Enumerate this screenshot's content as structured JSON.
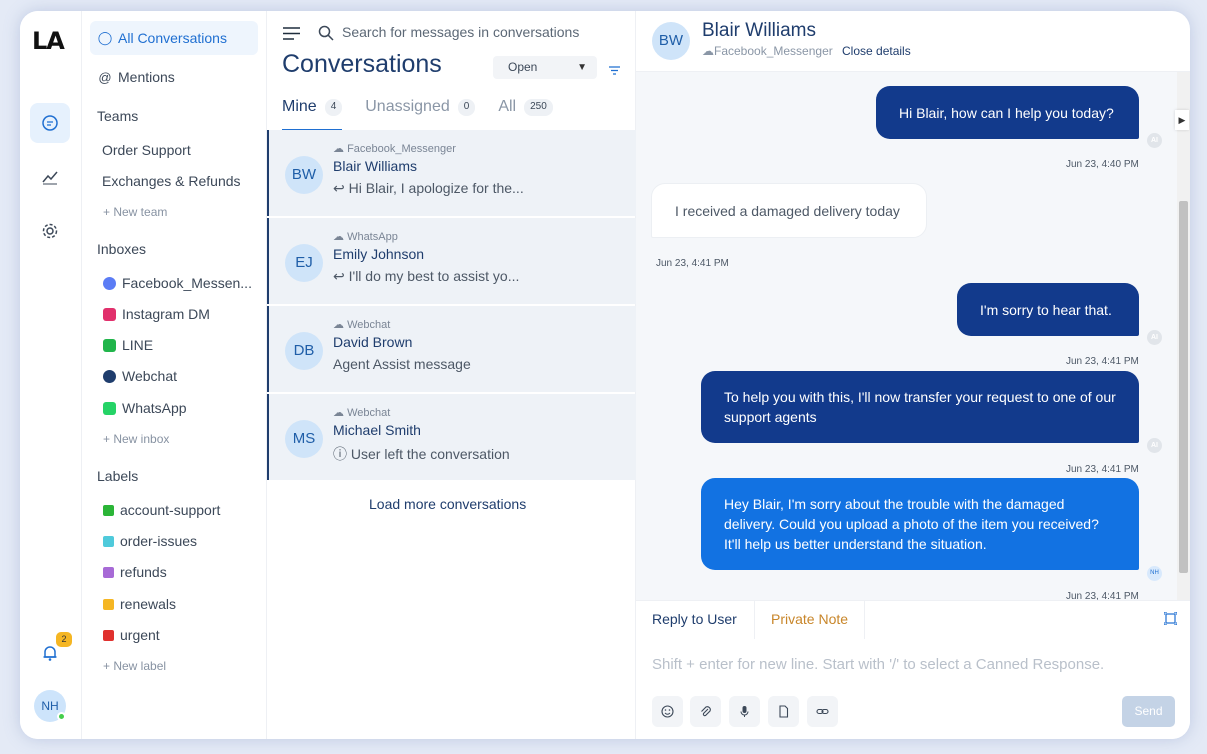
{
  "rail": {
    "logo": "LA",
    "notification_count": "2",
    "avatar_initials": "NH"
  },
  "sidebar": {
    "all_conversations": "All Conversations",
    "mentions": "Mentions",
    "teams_heading": "Teams",
    "teams": [
      "Order Support",
      "Exchanges & Refunds"
    ],
    "new_team": "+ New team",
    "inboxes_heading": "Inboxes",
    "inboxes": [
      {
        "label": "Facebook_Messen...",
        "color": "#3b6cf2"
      },
      {
        "label": "Instagram DM",
        "color": "#e1306c"
      },
      {
        "label": "LINE",
        "color": "#21b54b"
      },
      {
        "label": "Webchat",
        "color": "#1f3d6d"
      },
      {
        "label": "WhatsApp",
        "color": "#25d366"
      }
    ],
    "new_inbox": "+ New inbox",
    "labels_heading": "Labels",
    "labels": [
      {
        "label": "account-support",
        "color": "#2bb537"
      },
      {
        "label": "order-issues",
        "color": "#4fcadb"
      },
      {
        "label": "refunds",
        "color": "#a76ad6"
      },
      {
        "label": "renewals",
        "color": "#f5b623"
      },
      {
        "label": "urgent",
        "color": "#e0312e"
      }
    ],
    "new_label": "+ New label"
  },
  "list": {
    "search_placeholder": "Search for messages in conversations",
    "title": "Conversations",
    "status": "Open",
    "tabs": [
      {
        "label": "Mine",
        "count": "4"
      },
      {
        "label": "Unassigned",
        "count": "0"
      },
      {
        "label": "All",
        "count": "250"
      }
    ],
    "conversations": [
      {
        "initials": "BW",
        "source": "Facebook_Messenger",
        "name": "Blair Williams",
        "preview": "Hi Blair, I apologize for the..."
      },
      {
        "initials": "EJ",
        "source": "WhatsApp",
        "name": "Emily Johnson",
        "preview": "I'll do my best to assist yo..."
      },
      {
        "initials": "DB",
        "source": "Webchat",
        "name": "David Brown",
        "preview": "Agent Assist message"
      },
      {
        "initials": "MS",
        "source": "Webchat",
        "name": "Michael Smith",
        "preview": "User left the conversation"
      }
    ],
    "load_more": "Load more conversations"
  },
  "chat": {
    "initials": "BW",
    "name": "Blair Williams",
    "source": "Facebook_Messenger",
    "close_details": "Close details",
    "messages": [
      {
        "text": "Hi Blair, how can I help you today?",
        "time": "Jun 23, 4:40 PM",
        "sender": "AI"
      },
      {
        "text": "I received a damaged delivery today",
        "time": "Jun 23, 4:41 PM",
        "sender": "user"
      },
      {
        "text": "I'm sorry to hear that.",
        "time": "Jun 23, 4:41 PM",
        "sender": "AI"
      },
      {
        "text": "To help you with this, I'll now transfer your request to one of our support agents",
        "time": "Jun 23, 4:41 PM",
        "sender": "AI"
      },
      {
        "text": "Hey Blair, I'm sorry about the trouble with the damaged delivery. Could you upload a photo of the item you received? It'll help us better understand the situation.",
        "time": "Jun 23, 4:41 PM",
        "sender": "NH"
      }
    ]
  },
  "reply": {
    "tab_reply": "Reply to User",
    "tab_note": "Private Note",
    "placeholder": "Shift + enter for new line. Start with '/' to select a Canned Response.",
    "send": "Send"
  }
}
